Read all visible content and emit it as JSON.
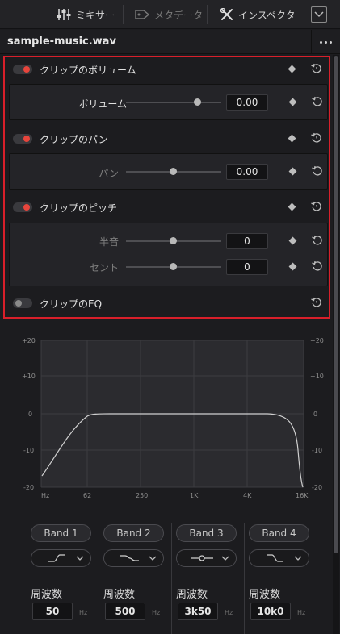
{
  "toolbar": {
    "mixer": "ミキサー",
    "metadata": "メタデータ",
    "inspector": "インスペクタ"
  },
  "file": {
    "name": "sample-music.wav"
  },
  "sections": {
    "volume": {
      "title": "クリップのボリューム",
      "enabled": true,
      "param_label": "ボリューム",
      "value": "0.00",
      "slider_position": 0.75
    },
    "pan": {
      "title": "クリップのパン",
      "enabled": true,
      "param_label": "パン",
      "value": "0.00",
      "slider_position": 0.5
    },
    "pitch": {
      "title": "クリップのピッチ",
      "enabled": true,
      "semitone_label": "半音",
      "semitone_value": "0",
      "semitone_position": 0.5,
      "cent_label": "セント",
      "cent_value": "0",
      "cent_position": 0.5
    },
    "eq": {
      "title": "クリップのEQ",
      "enabled": false
    }
  },
  "eq_graph": {
    "y_ticks": [
      "+20",
      "+10",
      "0",
      "-10",
      "-20"
    ],
    "x_ticks": [
      "Hz",
      "62",
      "250",
      "1K",
      "4K",
      "16K"
    ]
  },
  "bands": [
    {
      "label": "Band 1",
      "filter": "low-shelf-icon",
      "freq_label": "周波数",
      "freq": "50",
      "unit": "Hz"
    },
    {
      "label": "Band 2",
      "filter": "bell-icon",
      "freq_label": "周波数",
      "freq": "500",
      "unit": "Hz"
    },
    {
      "label": "Band 3",
      "filter": "bell-icon",
      "freq_label": "周波数",
      "freq": "3k50",
      "unit": "Hz"
    },
    {
      "label": "Band 4",
      "filter": "high-shelf-icon",
      "freq_label": "周波数",
      "freq": "10k0",
      "unit": "Hz"
    }
  ],
  "colors": {
    "highlight": "#d81f2a",
    "toggle_on": "#e8453c",
    "curve": "#d0d0d0"
  }
}
